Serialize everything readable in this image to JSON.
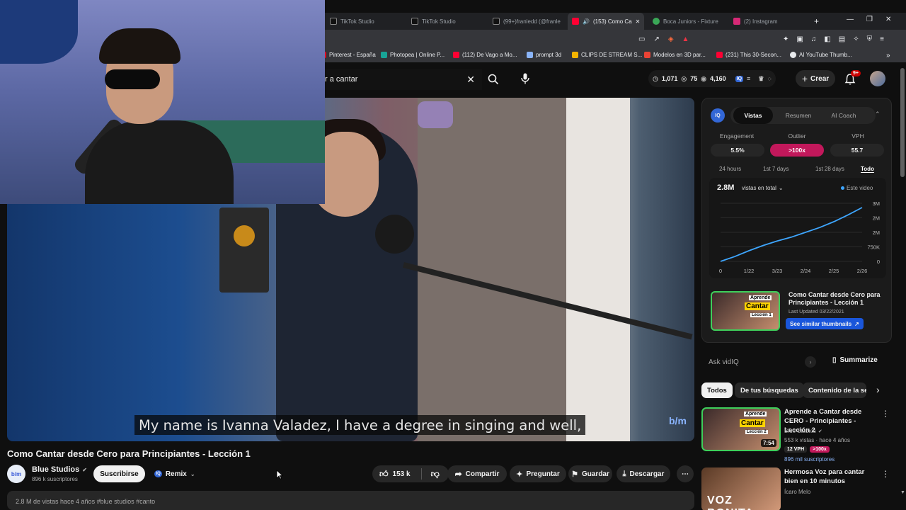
{
  "browser": {
    "tabs": [
      {
        "label": "TikTok Studio",
        "fav": "#111"
      },
      {
        "label": "TikTok Studio",
        "fav": "#111"
      },
      {
        "label": "(99+)franledd (@franle",
        "fav": "#111"
      },
      {
        "label": "(153) Como Ca",
        "fav": "#ff0033"
      },
      {
        "label": "Boca Juniors - Fixture",
        "fav": "#3aa757"
      },
      {
        "label": "(2) Instagram",
        "fav": "#d62976"
      }
    ],
    "new_tab": "+",
    "bookmarks": [
      {
        "label": "Pinterest - España",
        "fav": "#e60023"
      },
      {
        "label": "Photopea | Online P...",
        "fav": "#18a497"
      },
      {
        "label": "(112) De Vago a Mo...",
        "fav": "#ff0033"
      },
      {
        "label": "prompt 3d",
        "fav": "#8ab4f8"
      },
      {
        "label": "CLIPS DE STREAM S...",
        "fav": "#f4b400"
      },
      {
        "label": "Modelos en 3D par...",
        "fav": "#ea4335"
      },
      {
        "label": "(231) This 30-Secon...",
        "fav": "#ff0033"
      },
      {
        "label": "AI YouTube Thumb...",
        "fav": "#e8eaed"
      }
    ],
    "more_bookmarks": "»"
  },
  "header": {
    "search_value": "r a cantar",
    "stat_views": "1,071",
    "stat_likes": "75",
    "stat_eye": "4,160",
    "create_label": "Crear",
    "notif_count": "9+"
  },
  "video": {
    "caption": "My name is Ivanna Valadez, I have a degree in singing and well,",
    "watermark": "b/m",
    "title": "Como Cantar desde Cero para Principiantes - Lección 1"
  },
  "channel": {
    "name": "Blue Studios",
    "subs": "896 k suscriptores",
    "avatar_text": "b/m",
    "subscribe_label": "Suscribirse",
    "remix_label": "Remix",
    "likes": "153 k",
    "share_label": "Compartir",
    "ask_label": "Preguntar",
    "save_label": "Guardar",
    "download_label": "Descargar",
    "more": "⋯",
    "desc_stub": "2.8 M de vistas  hace 4 años  #blue studios  #canto"
  },
  "vidiq": {
    "badge": "IQ",
    "tabs": [
      "Vistas",
      "Resumen",
      "AI Coach"
    ],
    "metrics": [
      {
        "label": "Engagement",
        "value": "5.5%"
      },
      {
        "label": "Outlier",
        "value": ">100x"
      },
      {
        "label": "VPH",
        "value": "55.7"
      }
    ],
    "ranges": [
      "24 hours",
      "1st 7 days",
      "1st 28 days",
      "Todo"
    ],
    "total": "2.8M",
    "total_label": "vistas en total",
    "legend": "Este video",
    "thumb_title": "Como Cantar desde Cero para Principiantes - Lección 1",
    "last_updated": "Last Updated 03/22/2021",
    "similar_btn": "See similar thumbnails",
    "thumb_text_1": "Aprende",
    "thumb_text_2": "Cantar",
    "thumb_text_3": "Lección 1",
    "accent": "#ff3366"
  },
  "chart_data": {
    "type": "line",
    "x_ticks": [
      "0",
      "1/22",
      "3/23",
      "2/24",
      "2/25",
      "2/26"
    ],
    "y_ticks": [
      "3M",
      "2M",
      "2M",
      "750K",
      "0"
    ],
    "ylim": [
      0,
      3000000
    ],
    "series": [
      {
        "name": "Este video",
        "x": [
          0,
          0.5,
          1,
          1.5,
          2,
          2.5,
          3,
          3.5,
          4,
          4.5,
          5
        ],
        "values": [
          0,
          250000,
          550000,
          820000,
          1050000,
          1250000,
          1500000,
          1750000,
          2050000,
          2400000,
          2780000
        ]
      }
    ],
    "color": "#3ea6ff"
  },
  "ask": {
    "placeholder": "Ask vidIQ",
    "summarize_label": "Summarize"
  },
  "chips": [
    "Todos",
    "De tus búsquedas",
    "Contenido de la ser"
  ],
  "recs": [
    {
      "title": "Aprende a Cantar desde CERO - Principiantes - Lección 2",
      "channel": "Blue Studios",
      "meta": "553 k vistas · hace 4 años",
      "vph": "12 VPH",
      "outlier": ">100x",
      "subs_label": "896 mil suscriptores",
      "duration": "7:54",
      "thumb_text_1": "Aprende",
      "thumb_text_2": "Cantar",
      "thumb_text_3": "Lección 2"
    },
    {
      "title": "Hermosa Voz para cantar bien en 10 minutos",
      "channel": "Ícaro Melo",
      "thumb_text_1": "VOZ BONITA"
    }
  ]
}
